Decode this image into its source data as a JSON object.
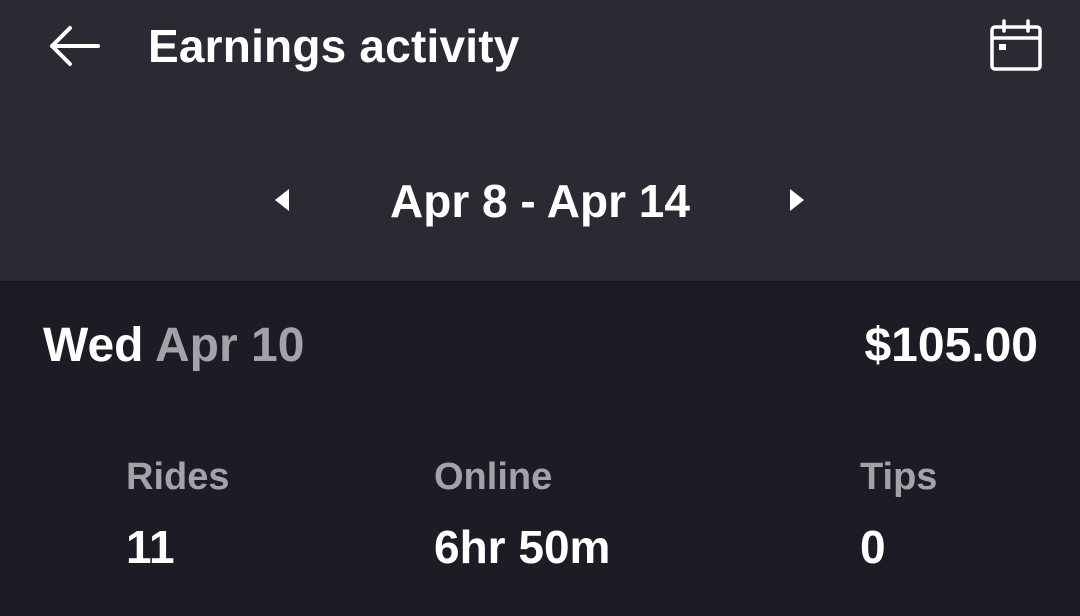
{
  "header": {
    "title": "Earnings activity",
    "back_icon": "arrow-left-icon",
    "calendar_icon": "calendar-icon"
  },
  "week_selector": {
    "range": "Apr 8 - Apr 14",
    "prev_icon": "triangle-left-icon",
    "next_icon": "triangle-right-icon"
  },
  "day": {
    "weekday": "Wed",
    "date": "Apr 10",
    "total": "$105.00",
    "stats": [
      {
        "label": "Rides",
        "value": "11"
      },
      {
        "label": "Online",
        "value": "6hr 50m"
      },
      {
        "label": "Tips",
        "value": "0"
      }
    ]
  },
  "colors": {
    "header_bg": "#2a2a33",
    "body_bg": "#1c1c24",
    "text_primary": "#ffffff",
    "text_secondary": "#a2a2a8"
  }
}
